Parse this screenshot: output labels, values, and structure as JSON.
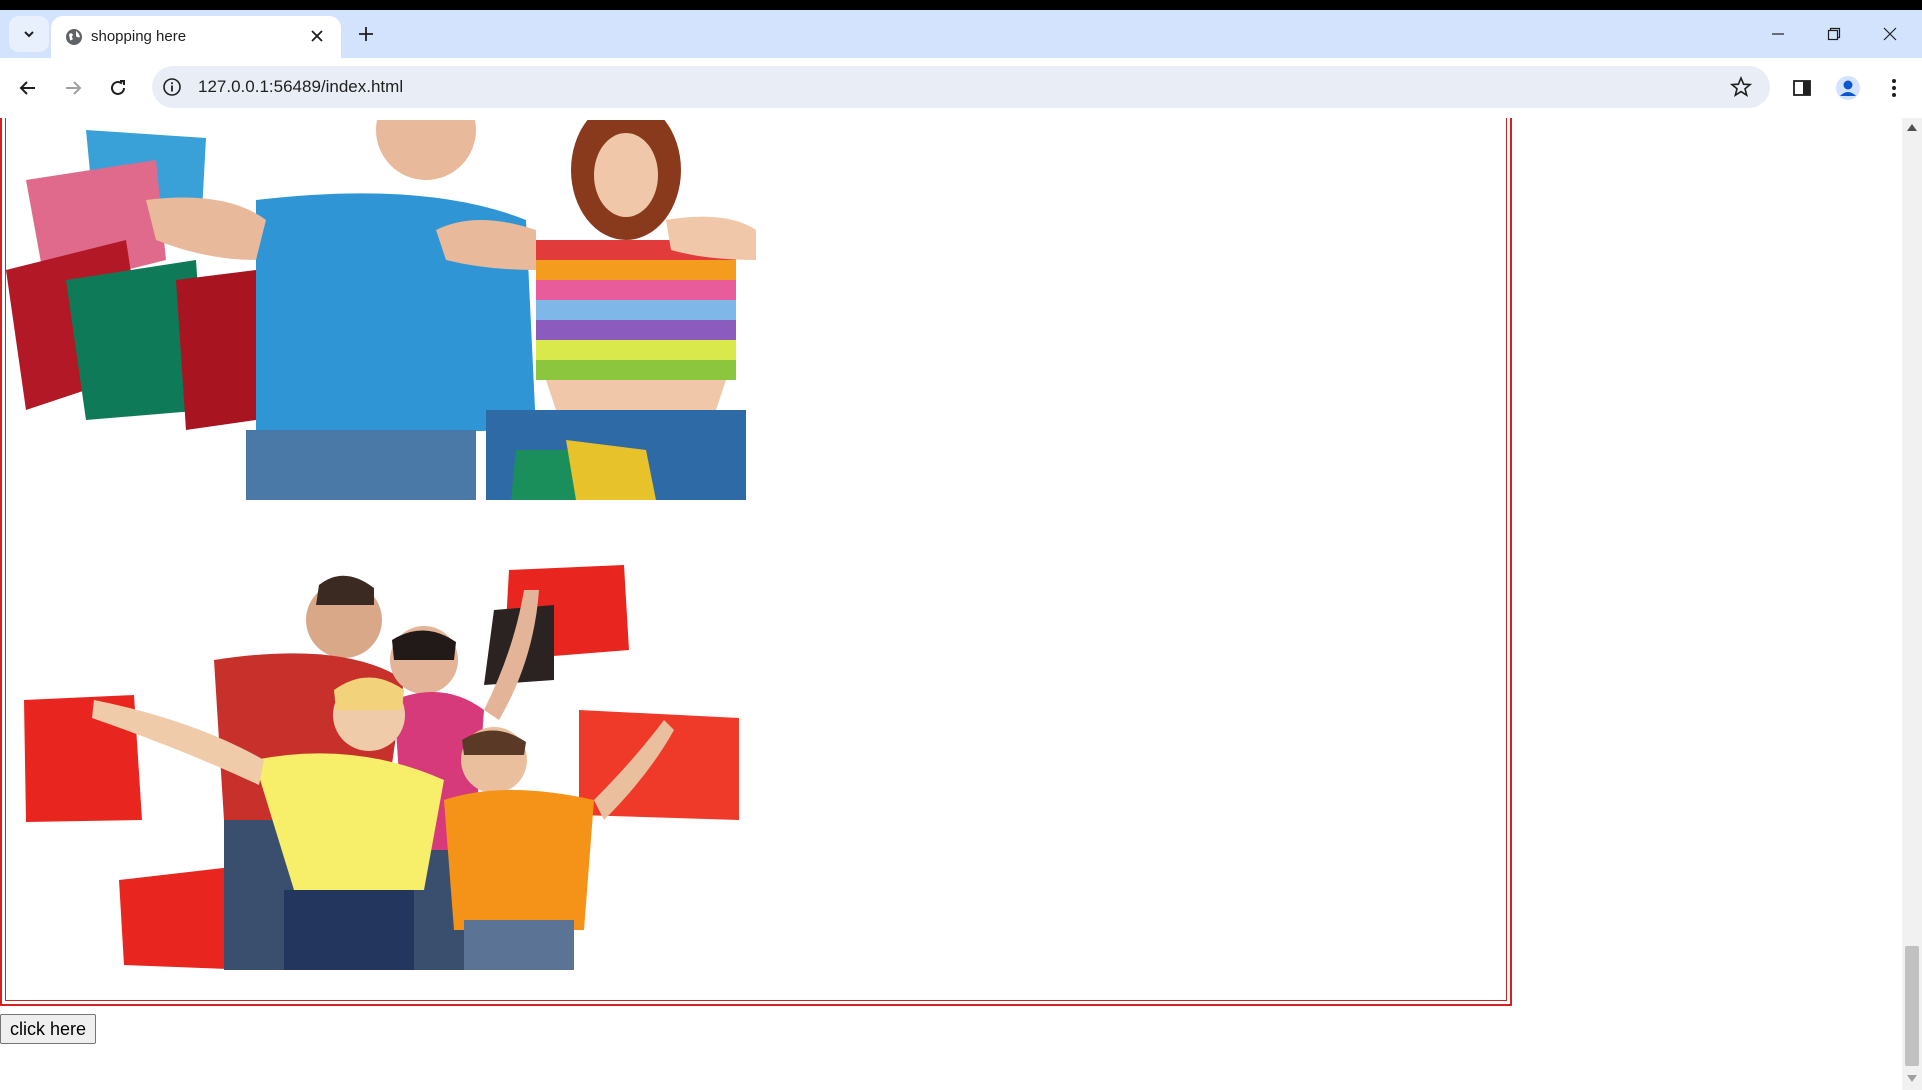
{
  "browser": {
    "tab_title": "shopping here",
    "url": "127.0.0.1:56489/index.html"
  },
  "page": {
    "button_label": "click here",
    "images": [
      {
        "subject": "couple holding shopping bags giving thumbs up"
      },
      {
        "subject": "family with shopping bags"
      }
    ]
  },
  "colors": {
    "tabstrip": "#d3e3fd",
    "frame_border": "#d32020",
    "omnibox": "#e9eef6"
  }
}
